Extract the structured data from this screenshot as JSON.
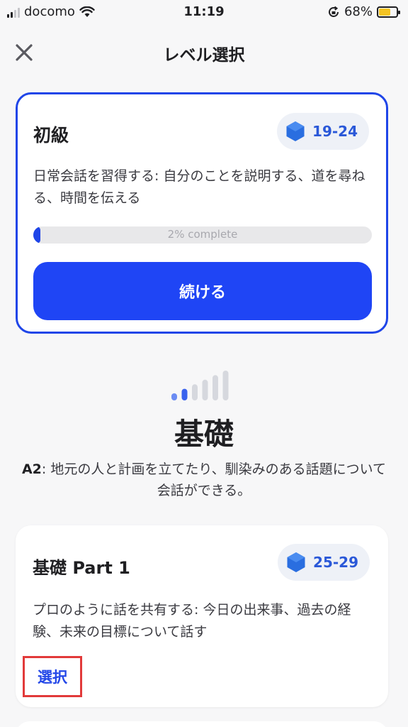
{
  "status_bar": {
    "carrier": "docomo",
    "time": "11:19",
    "battery": "68%",
    "battery_level": 0.68
  },
  "header": {
    "title": "レベル選択"
  },
  "current_level": {
    "title": "初級",
    "range": "19-24",
    "description": "日常会話を習得する: 自分のことを説明する、道を尋ねる、時間を伝える",
    "progress": 0.02,
    "progress_label": "2% complete",
    "continue_label": "続ける"
  },
  "section": {
    "meter_level": 2,
    "meter_total": 6,
    "title": "基礎",
    "code": "A2",
    "description": ": 地元の人と計画を立てたり、馴染みのある話題について会話ができる。"
  },
  "part": {
    "title": "基礎 Part 1",
    "range": "25-29",
    "description": "プロのように話を共有する: 今日の出来事、過去の経験、未来の目標について話す",
    "select_label": "選択"
  },
  "colors": {
    "accent": "#1f45f5",
    "highlight_box": "#e23a3a",
    "hex_icon": "#2a6ee0"
  }
}
